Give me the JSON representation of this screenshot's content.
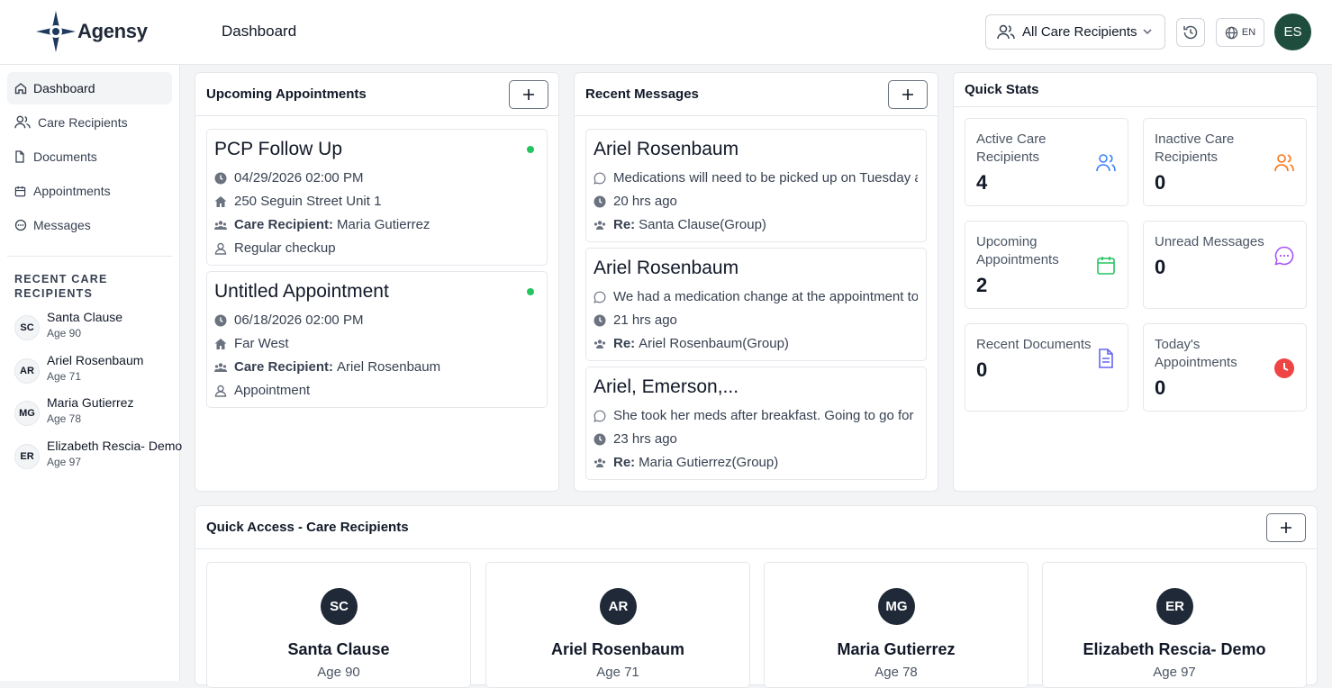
{
  "app": {
    "name": "Agensy",
    "page_title": "Dashboard"
  },
  "header": {
    "recipient_select": {
      "value": "All Care Recipients",
      "icon": "users-icon"
    },
    "history_icon": "history-icon",
    "language": "EN",
    "user_initials": "ES"
  },
  "sidebar": {
    "items": [
      {
        "label": "Dashboard",
        "icon": "home-icon",
        "active": true
      },
      {
        "label": "Care Recipients",
        "icon": "users-icon"
      },
      {
        "label": "Documents",
        "icon": "file-icon"
      },
      {
        "label": "Appointments",
        "icon": "calendar-icon"
      },
      {
        "label": "Messages",
        "icon": "message-icon"
      }
    ],
    "section_title": "RECENT CARE RECIPIENTS",
    "recipients": [
      {
        "initials": "SC",
        "name": "Santa Clause",
        "age": "Age 90"
      },
      {
        "initials": "AR",
        "name": "Ariel Rosenbaum",
        "age": "Age 71"
      },
      {
        "initials": "MG",
        "name": "Maria Gutierrez",
        "age": "Age 78"
      },
      {
        "initials": "ER",
        "name": "Elizabeth Rescia- Demo",
        "age": "Age 97"
      }
    ]
  },
  "appointments": {
    "title": "Upcoming Appointments",
    "care_recipient_label": "Care Recipient:",
    "items": [
      {
        "title": "PCP Follow Up",
        "datetime": "04/29/2026 02:00 PM",
        "location": "250 Seguin Street Unit 1",
        "recipient": "Maria Gutierrez",
        "type": "Regular checkup"
      },
      {
        "title": "Untitled Appointment",
        "datetime": "06/18/2026 02:00 PM",
        "location": "Far West",
        "recipient": "Ariel Rosenbaum",
        "type": "Appointment"
      }
    ]
  },
  "messages": {
    "title": "Recent Messages",
    "re_label": "Re:",
    "items": [
      {
        "sender": "Ariel Rosenbaum",
        "text": "Medications will need to be picked up on Tuesday at the pharmacy",
        "time": "20 hrs ago",
        "re": "Santa Clause(Group)"
      },
      {
        "sender": "Ariel Rosenbaum",
        "text": "We had a medication change at the appointment today",
        "time": "21 hrs ago",
        "re": "Ariel Rosenbaum(Group)"
      },
      {
        "sender": "Ariel, Emerson,...",
        "text": "She took her meds after breakfast. Going to go for a walk now",
        "time": "23 hrs ago",
        "re": "Maria Gutierrez(Group)"
      }
    ]
  },
  "quick_stats": {
    "title": "Quick Stats",
    "items": [
      {
        "label": "Active Care Recipients",
        "value": "4",
        "icon": "users-icon",
        "color": "#3b82f6"
      },
      {
        "label": "Inactive Care Recipients",
        "value": "0",
        "icon": "users-icon",
        "color": "#f97316"
      },
      {
        "label": "Upcoming Appointments",
        "value": "2",
        "icon": "calendar-icon",
        "color": "#22c55e"
      },
      {
        "label": "Unread Messages",
        "value": "0",
        "icon": "message-icon",
        "color": "#a855f7"
      },
      {
        "label": "Recent Documents",
        "value": "0",
        "icon": "document-icon",
        "color": "#6366f1"
      },
      {
        "label": "Today's Appointments",
        "value": "0",
        "icon": "clock-icon",
        "color": "#ef4444"
      }
    ]
  },
  "quick_access": {
    "title": "Quick Access - Care Recipients",
    "recipients": [
      {
        "initials": "SC",
        "name": "Santa Clause",
        "age": "Age 90"
      },
      {
        "initials": "AR",
        "name": "Ariel Rosenbaum",
        "age": "Age 71"
      },
      {
        "initials": "MG",
        "name": "Maria Gutierrez",
        "age": "Age 78"
      },
      {
        "initials": "ER",
        "name": "Elizabeth Rescia- Demo",
        "age": "Age 97"
      }
    ]
  }
}
